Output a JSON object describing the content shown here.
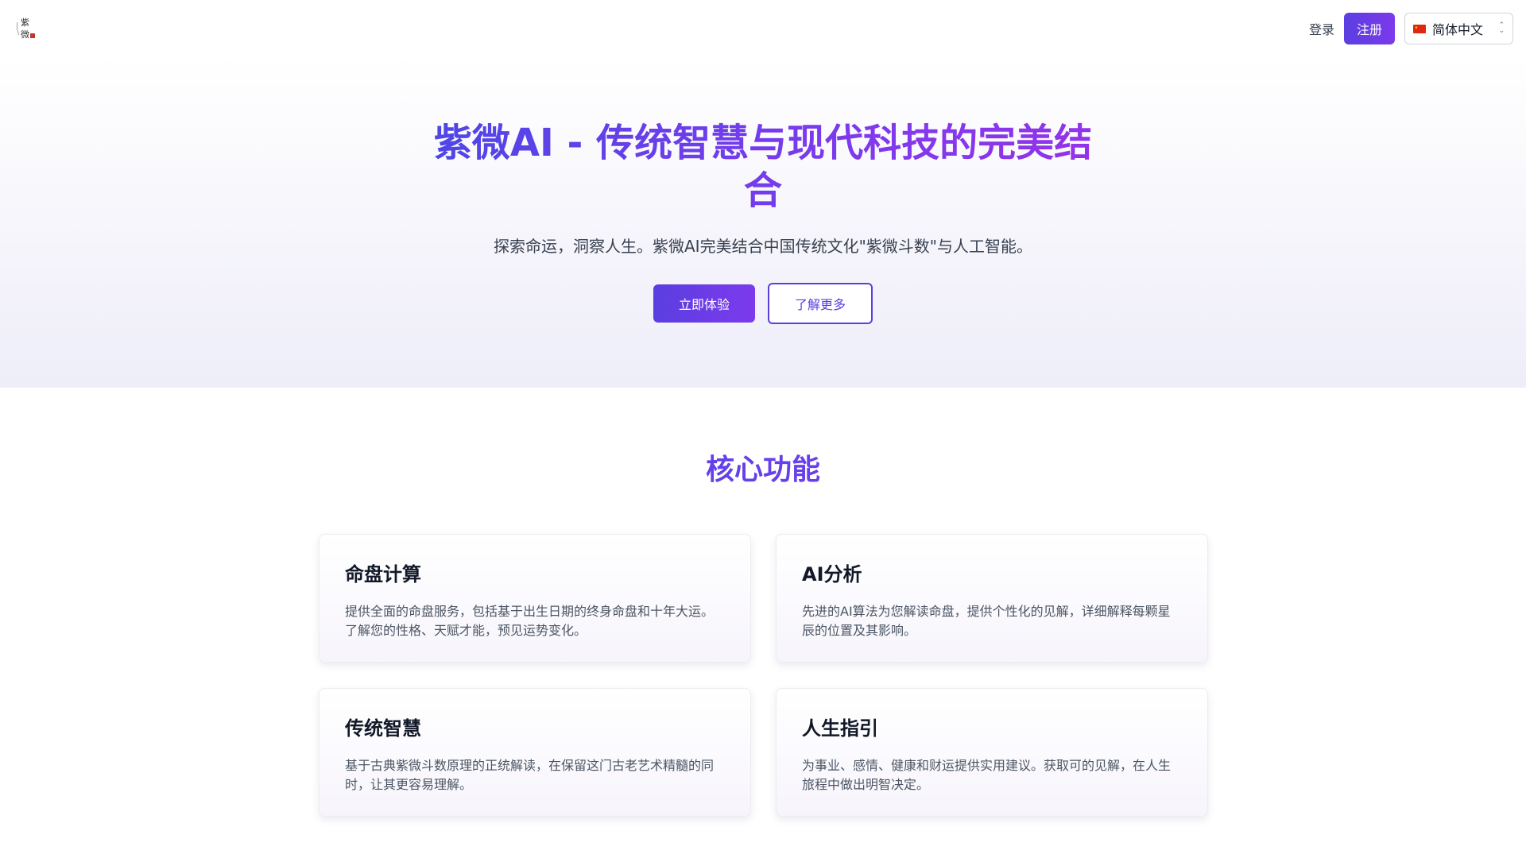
{
  "header": {
    "logo_alt": "紫微",
    "login_label": "登录",
    "register_label": "注册",
    "language": {
      "selected": "简体中文",
      "flag": "cn-flag-icon"
    }
  },
  "hero": {
    "title": "紫微AI - 传统智慧与现代科技的完美结合",
    "subtitle": "探索命运，洞察人生。紫微AI完美结合中国传统文化\"紫微斗数\"与人工智能。",
    "primary_button": "立即体验",
    "secondary_button": "了解更多"
  },
  "features": {
    "title": "核心功能",
    "cards": [
      {
        "title": "命盘计算",
        "text": "提供全面的命盘服务，包括基于出生日期的终身命盘和十年大运。了解您的性格、天赋才能，预见运势变化。"
      },
      {
        "title": "AI分析",
        "text": "先进的AI算法为您解读命盘，提供个性化的见解，详细解释每颗星辰的位置及其影响。"
      },
      {
        "title": "传统智慧",
        "text": "基于古典紫微斗数原理的正统解读，在保留这门古老艺术精髓的同时，让其更容易理解。"
      },
      {
        "title": "人生指引",
        "text": "为事业、感情、健康和财运提供实用建议。获取可的见解，在人生旅程中做出明智决定。"
      }
    ]
  },
  "colors": {
    "accent": "#5b3ee0",
    "accent_end": "#7c3aed"
  }
}
